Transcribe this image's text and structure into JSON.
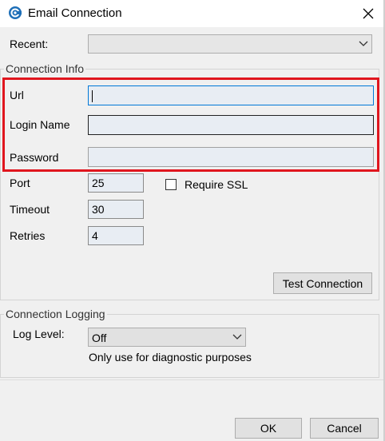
{
  "window": {
    "title": "Email Connection"
  },
  "recent": {
    "label": "Recent:",
    "value": ""
  },
  "connection_info": {
    "group_title": "Connection Info",
    "url_label": "Url",
    "url_value": "",
    "login_label": "Login Name",
    "login_value": "",
    "password_label": "Password",
    "password_value": "",
    "port_label": "Port",
    "port_value": "25",
    "timeout_label": "Timeout",
    "timeout_value": "30",
    "retries_label": "Retries",
    "retries_value": "4",
    "ssl_label": "Require SSL",
    "ssl_checked": false,
    "test_button": "Test Connection"
  },
  "connection_logging": {
    "group_title": "Connection Logging",
    "level_label": "Log Level:",
    "level_value": "Off",
    "hint": "Only use for diagnostic purposes"
  },
  "footer": {
    "ok_label": "OK",
    "cancel_label": "Cancel"
  },
  "colors": {
    "highlight": "#e0161e",
    "accent": "#0078d7",
    "app_icon": "#1e6fb8"
  },
  "icons": {
    "app": "connection-icon",
    "close": "close-icon",
    "dropdown": "chevron-down-icon"
  }
}
